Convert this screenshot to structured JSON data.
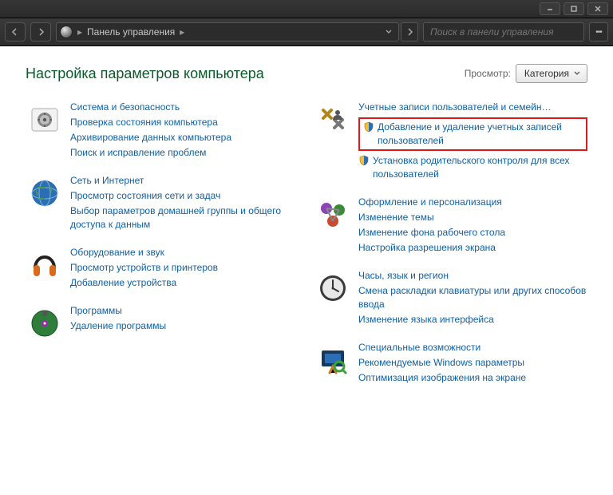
{
  "breadcrumb": {
    "root": "Панель управления"
  },
  "search": {
    "placeholder": "Поиск в панели управления"
  },
  "page_title": "Настройка параметров компьютера",
  "viewby_label": "Просмотр:",
  "viewby_value": "Категория",
  "left": [
    {
      "name": "Система и безопасность",
      "links": [
        "Проверка состояния компьютера",
        "Архивирование данных компьютера",
        "Поиск и исправление проблем"
      ]
    },
    {
      "name": "Сеть и Интернет",
      "links": [
        "Просмотр состояния сети и задач",
        "Выбор параметров домашней группы и общего доступа к данным"
      ]
    },
    {
      "name": "Оборудование и звук",
      "links": [
        "Просмотр устройств и принтеров",
        "Добавление устройства"
      ]
    },
    {
      "name": "Программы",
      "links": [
        "Удаление программы"
      ]
    }
  ],
  "right": [
    {
      "name": "Учетные записи пользователей и семейн…",
      "links": [
        {
          "text": "Добавление и удаление учетных записей пользователей",
          "shield": true,
          "highlight": true
        },
        {
          "text": "Установка родительского контроля для всех пользователей",
          "shield": true
        }
      ]
    },
    {
      "name": "Оформление и персонализация",
      "links": [
        "Изменение темы",
        "Изменение фона рабочего стола",
        "Настройка разрешения экрана"
      ]
    },
    {
      "name": "Часы, язык и регион",
      "links": [
        "Смена раскладки клавиатуры или других способов ввода",
        "Изменение языка интерфейса"
      ]
    },
    {
      "name": "Специальные возможности",
      "links": [
        "Рекомендуемые Windows параметры",
        "Оптимизация изображения на экране"
      ]
    }
  ]
}
